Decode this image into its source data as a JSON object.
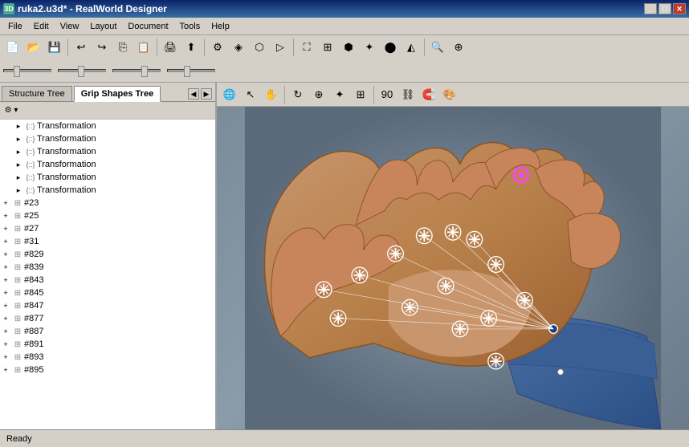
{
  "title_bar": {
    "title": "ruka2.u3d* - RealWorld Designer",
    "icon": "3d",
    "buttons": [
      "minimize",
      "maximize",
      "close"
    ]
  },
  "menu": {
    "items": [
      "File",
      "Edit",
      "View",
      "Layout",
      "Document",
      "Tools",
      "Help"
    ]
  },
  "tabs": {
    "structure_tree": "Structure Tree",
    "grip_shapes_tree": "Grip Shapes Tree",
    "active": "grip_shapes_tree"
  },
  "tree": {
    "toolbar_btn": "▾",
    "items": [
      {
        "id": "root",
        "label": "▾",
        "level": 0,
        "type": "dropdown"
      },
      {
        "id": "t1",
        "label": "Transformation",
        "level": 1,
        "type": "transformation"
      },
      {
        "id": "t2",
        "label": "Transformation",
        "level": 1,
        "type": "transformation"
      },
      {
        "id": "t3",
        "label": "Transformation",
        "level": 1,
        "type": "transformation"
      },
      {
        "id": "t4",
        "label": "Transformation",
        "level": 1,
        "type": "transformation"
      },
      {
        "id": "t5",
        "label": "Transformation",
        "level": 1,
        "type": "transformation"
      },
      {
        "id": "t6",
        "label": "Transformation",
        "level": 1,
        "type": "transformation"
      },
      {
        "id": "n23",
        "label": "#23",
        "level": 0,
        "type": "node"
      },
      {
        "id": "n25",
        "label": "#25",
        "level": 0,
        "type": "node"
      },
      {
        "id": "n27",
        "label": "#27",
        "level": 0,
        "type": "node"
      },
      {
        "id": "n31",
        "label": "#31",
        "level": 0,
        "type": "node"
      },
      {
        "id": "n829",
        "label": "#829",
        "level": 0,
        "type": "node"
      },
      {
        "id": "n839",
        "label": "#839",
        "level": 0,
        "type": "node"
      },
      {
        "id": "n843",
        "label": "#843",
        "level": 0,
        "type": "node"
      },
      {
        "id": "n845",
        "label": "#845",
        "level": 0,
        "type": "node"
      },
      {
        "id": "n847",
        "label": "#847",
        "level": 0,
        "type": "node"
      },
      {
        "id": "n877",
        "label": "#877",
        "level": 0,
        "type": "node"
      },
      {
        "id": "n887",
        "label": "#887",
        "level": 0,
        "type": "node"
      },
      {
        "id": "n891",
        "label": "#891",
        "level": 0,
        "type": "node"
      },
      {
        "id": "n893",
        "label": "#893",
        "level": 0,
        "type": "node"
      },
      {
        "id": "n895",
        "label": "#895",
        "level": 0,
        "type": "node"
      }
    ]
  },
  "viewport": {
    "toolbar_btns": [
      "globe",
      "cursor",
      "hand",
      "rotate",
      "zoom",
      "pan",
      "grid",
      "snap",
      "angle90",
      "chain",
      "magnet",
      "paint"
    ]
  },
  "status": {
    "text": "Ready"
  },
  "colors": {
    "accent_blue": "#316ac5",
    "bg_gray": "#d4d0c8",
    "viewport_bg": "#7a8b9a"
  }
}
